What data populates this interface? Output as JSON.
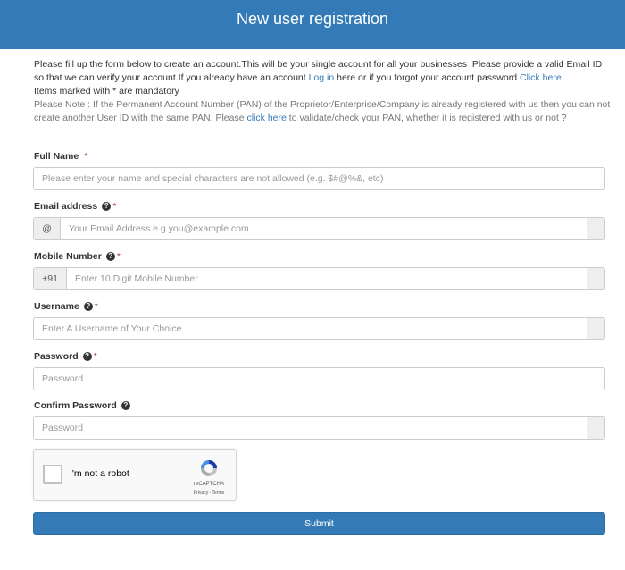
{
  "header": {
    "title": "New user registration"
  },
  "intro": {
    "line1_a": "Please fill up the form below to create an account.This will be your single account for all your businesses .Please provide a valid Email ID so that we can verify your account.If you already have an account ",
    "login_link": "Log in",
    "line1_b": " here or if you forgot your account password ",
    "forgot_link": "Click here.",
    "mandatory": "Items marked with * are mandatory",
    "note_a": "Please Note : If the Permanent Account Number (PAN) of the Proprietor/Enterprise/Company is already registered with us then you can not create another User ID with the same PAN. Please ",
    "check_link": "click here",
    "note_b": " to validate/check your PAN, whether it is registered with us or not ?"
  },
  "form": {
    "full_name": {
      "label": "Full Name",
      "required": "*",
      "placeholder": "Please enter your name and special characters are not allowed (e.g. $#@%&, etc)"
    },
    "email": {
      "label": "Email address",
      "required": "*",
      "addon": "@",
      "placeholder": "Your Email Address e.g you@example.com"
    },
    "mobile": {
      "label": "Mobile Number",
      "required": "*",
      "addon": "+91",
      "placeholder": "Enter 10 Digit Mobile Number"
    },
    "username": {
      "label": "Username",
      "required": "*",
      "placeholder": "Enter A Username of Your Choice"
    },
    "password": {
      "label": "Password",
      "required": "*",
      "placeholder": "Password"
    },
    "confirm_password": {
      "label": "Confirm Password",
      "placeholder": "Password"
    },
    "help_glyph": "?"
  },
  "captcha": {
    "label": "I'm not a robot",
    "brand": "reCAPTCHA",
    "links": "Privacy - Terms"
  },
  "submit": {
    "label": "Submit"
  },
  "colors": {
    "primary": "#337ab7",
    "required": "#a94442",
    "note": "#777777"
  }
}
